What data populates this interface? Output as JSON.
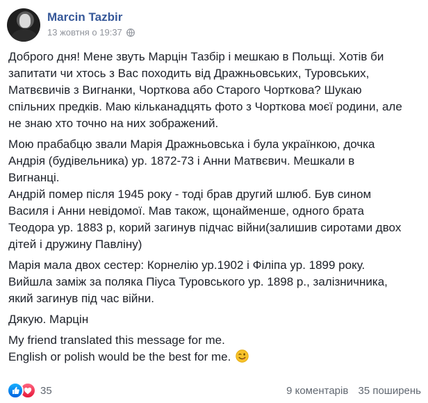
{
  "post": {
    "author": "Marcin Tazbir",
    "timestamp": "13 жовтня о 19:37",
    "privacy_icon": "globe-icon",
    "paragraphs": [
      {
        "lines": [
          "Доброго дня! Мене звуть Марцін Тазбір і мешкаю в Польщі. Хотів би",
          "запитати чи хтось з Вас походить від Дражньовських, Туровських,",
          "Матвєвичів з Вигнанки, Чорткова або Старого Чорткова? Шукаю",
          "спільних предків. Маю кільканадцять фото з Чорткова моєї родини, але",
          "не знаю хто точно на них зображений."
        ]
      },
      {
        "lines": [
          "Мою прабабцю звали Марія Дражньовська і була українкою, дочка",
          "Андрія (будівельника) ур. 1872-73 і Анни Матвєвич. Мешкали в",
          "Вигнанці.",
          "Андрій помер після 1945 року - тоді брав другий шлюб. Був сином",
          "Василя і Анни невідомої. Мав також, щонайменше, одного брата",
          "Теодора ур. 1883 р, корий загинув підчас війни(залишив сиротами двох",
          "дітей і дружину Павліну)"
        ]
      },
      {
        "lines": [
          "Марія мала двох сестер: Корнелію ур.1902 і Філіпа ур. 1899 року.",
          "Вийшла заміж за поляка Піуса Туровського ур. 1898 р., залізничника,",
          "який загинув під час війни."
        ]
      },
      {
        "lines": [
          "Дякую. Марцін"
        ]
      },
      {
        "lines": [
          "My friend translated this message for me.",
          "English or polish would be the best for me."
        ],
        "emoji": "wink-emoji"
      }
    ]
  },
  "footer": {
    "reaction_icons": [
      "like-reaction-icon",
      "love-reaction-icon"
    ],
    "reaction_count": "35",
    "comments": "9 коментарів",
    "shares": "35 поширень"
  },
  "colors": {
    "author_link": "#365899",
    "text": "#1d2129",
    "meta": "#90949c",
    "footer_text": "#606770",
    "like_blue": "#1877f2",
    "love_red": "#f33e58"
  }
}
